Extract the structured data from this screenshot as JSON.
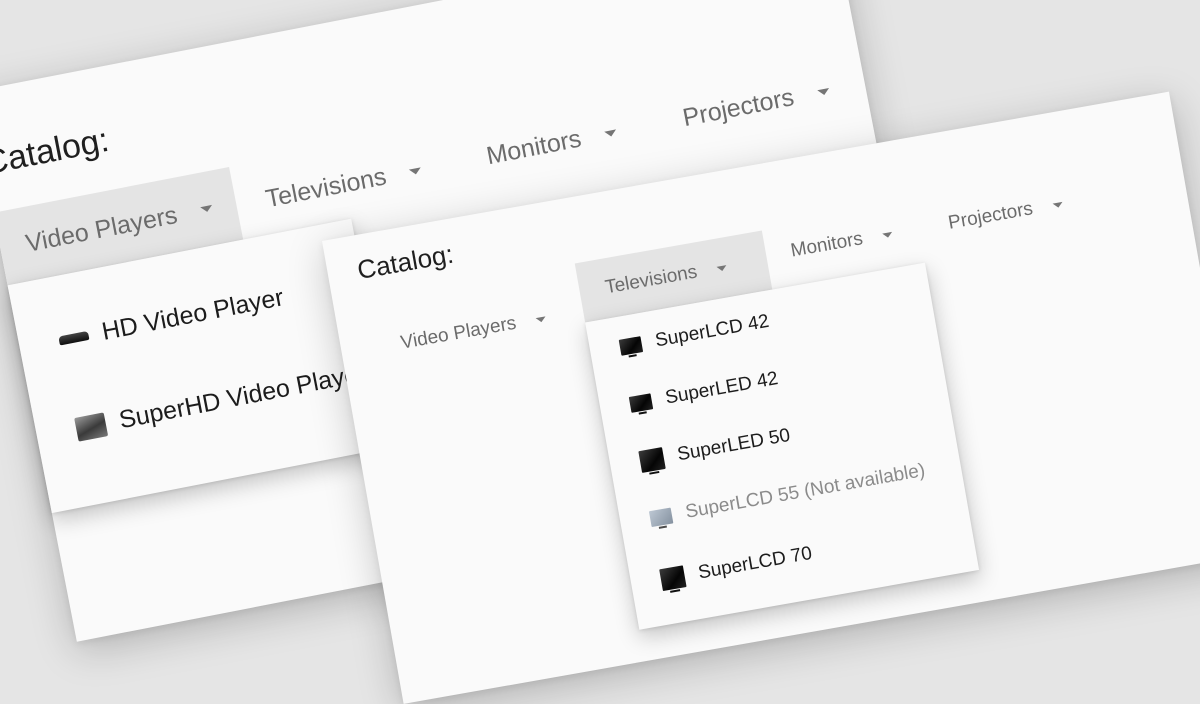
{
  "back_window": {
    "title": "Catalog:",
    "nav": [
      {
        "label": "Video Players",
        "selected": true
      },
      {
        "label": "Televisions",
        "selected": false
      },
      {
        "label": "Monitors",
        "selected": false
      },
      {
        "label": "Projectors",
        "selected": false
      }
    ],
    "dropdown_items": [
      {
        "label": "HD Video Player",
        "icon": "video-player-icon"
      },
      {
        "label": "SuperHD Video Player",
        "icon": "video-player-icon"
      }
    ]
  },
  "front_window": {
    "title": "Catalog:",
    "nav": [
      {
        "label": "Video Players",
        "selected": false
      },
      {
        "label": "Televisions",
        "selected": true
      },
      {
        "label": "Monitors",
        "selected": false
      },
      {
        "label": "Projectors",
        "selected": false
      }
    ],
    "dropdown_items": [
      {
        "label": "SuperLCD 42",
        "icon": "tv-icon",
        "disabled": false
      },
      {
        "label": "SuperLED 42",
        "icon": "tv-icon",
        "disabled": false
      },
      {
        "label": "SuperLED 50",
        "icon": "tv-icon",
        "disabled": false
      },
      {
        "label": "SuperLCD 55 (Not available)",
        "icon": "tv-icon",
        "disabled": true
      },
      {
        "label": "SuperLCD 70",
        "icon": "tv-icon",
        "disabled": false
      }
    ]
  },
  "colors": {
    "background": "#e5e5e5",
    "panel": "#fafafa",
    "selected_tab": "#e4e4e4",
    "text": "#1c1c1c",
    "muted_text": "#6b6b6b",
    "disabled_text": "#8b8b8b"
  }
}
